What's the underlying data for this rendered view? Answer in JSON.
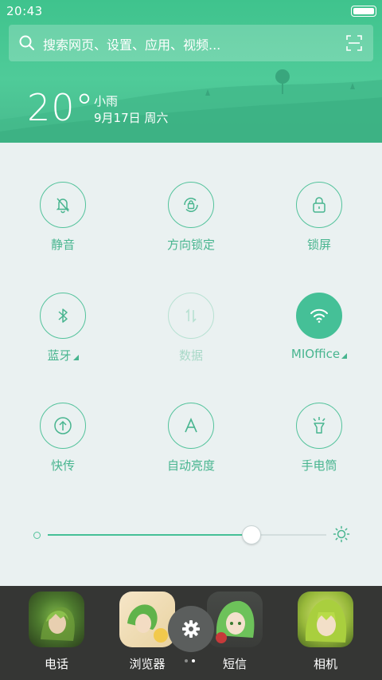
{
  "status_bar": {
    "time": "20:43"
  },
  "search": {
    "placeholder": "搜索网页、设置、应用、视频..."
  },
  "weather": {
    "temperature": "20°",
    "condition": "小雨",
    "date": "9月17日 周六"
  },
  "toggles": [
    {
      "label": "静音",
      "icon": "bell-off-icon",
      "active": false,
      "disabled": false
    },
    {
      "label": "方向锁定",
      "icon": "rotation-lock-icon",
      "active": false,
      "disabled": false
    },
    {
      "label": "锁屏",
      "icon": "lock-icon",
      "active": false,
      "disabled": false
    },
    {
      "label": "蓝牙",
      "icon": "bluetooth-icon",
      "active": false,
      "disabled": false,
      "expandable": true
    },
    {
      "label": "数据",
      "icon": "mobile-data-icon",
      "active": false,
      "disabled": true
    },
    {
      "label": "MIOffice",
      "icon": "wifi-icon",
      "active": true,
      "disabled": false,
      "expandable": true
    },
    {
      "label": "快传",
      "icon": "transfer-icon",
      "active": false,
      "disabled": false
    },
    {
      "label": "自动亮度",
      "icon": "auto-brightness-icon",
      "active": false,
      "disabled": false
    },
    {
      "label": "手电筒",
      "icon": "flashlight-icon",
      "active": false,
      "disabled": false
    }
  ],
  "brightness": {
    "level": 0.73
  },
  "dock": {
    "apps": [
      {
        "label": "电话"
      },
      {
        "label": "浏览器"
      },
      {
        "label": "短信"
      },
      {
        "label": "相机"
      }
    ],
    "page_indicator": {
      "pages": 2,
      "current": 2
    }
  },
  "colors": {
    "accent": "#45c097",
    "header": "#4fcb99",
    "panel": "#eaf1f1",
    "dock": "#353634"
  }
}
